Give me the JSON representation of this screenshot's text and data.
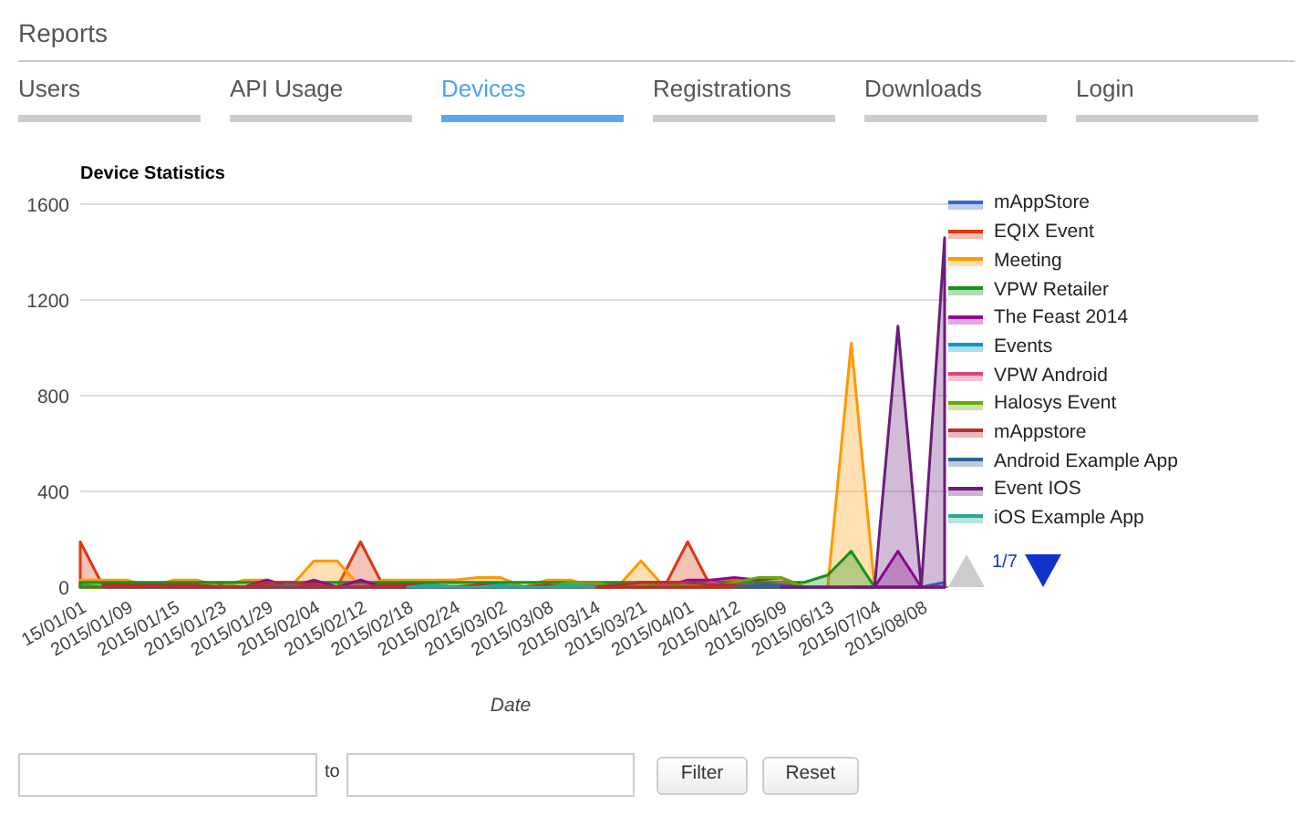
{
  "page_title": "Reports",
  "tabs": [
    {
      "label": "Users",
      "selected": false
    },
    {
      "label": "API Usage",
      "selected": false
    },
    {
      "label": "Devices",
      "selected": true
    },
    {
      "label": "Registrations",
      "selected": false
    },
    {
      "label": "Downloads",
      "selected": false
    },
    {
      "label": "Login",
      "selected": false
    }
  ],
  "chart": {
    "chart_data": {
      "type": "area",
      "title": "Device Statistics",
      "xlabel": "Date",
      "ylim": [
        0,
        1600
      ],
      "grid": true,
      "categories": [
        "15/01/01",
        null,
        "2015/01/09",
        null,
        "2015/01/15",
        null,
        "2015/01/23",
        null,
        "2015/01/29",
        null,
        "2015/02/04",
        null,
        "2015/02/12",
        null,
        "2015/02/18",
        null,
        "2015/02/24",
        null,
        "2015/03/02",
        null,
        "2015/03/08",
        null,
        "2015/03/14",
        null,
        "2015/03/21",
        null,
        "2015/04/01",
        null,
        "2015/04/12",
        null,
        "2015/05/09",
        null,
        "2015/06/13",
        null,
        "2015/07/04",
        null,
        "2015/08/08",
        null
      ],
      "yticks": [
        0,
        400,
        800,
        1200,
        1600
      ],
      "series": [
        {
          "name": "mAppStore",
          "color": "#3366cc",
          "values": [
            10,
            0,
            10,
            0,
            0,
            0,
            0,
            0,
            10,
            0,
            0,
            0,
            0,
            0,
            0,
            10,
            0,
            0,
            0,
            0,
            0,
            0,
            0,
            0,
            0,
            0,
            0,
            0,
            0,
            0,
            0,
            0,
            0,
            0,
            0,
            0,
            0,
            20
          ]
        },
        {
          "name": "EQIX Event",
          "color": "#dc3912",
          "values": [
            190,
            0,
            0,
            10,
            0,
            0,
            10,
            0,
            0,
            0,
            0,
            0,
            190,
            0,
            0,
            0,
            0,
            0,
            0,
            0,
            0,
            0,
            0,
            0,
            0,
            0,
            190,
            0,
            0,
            0,
            0,
            null,
            null,
            null,
            null,
            null,
            null,
            null
          ]
        },
        {
          "name": "Meeting",
          "color": "#ff9900",
          "values": [
            30,
            30,
            30,
            0,
            30,
            30,
            0,
            30,
            30,
            0,
            110,
            110,
            0,
            30,
            30,
            30,
            30,
            40,
            40,
            0,
            30,
            30,
            0,
            0,
            110,
            0,
            0,
            30,
            30,
            0,
            0,
            0,
            0,
            1020,
            0,
            0,
            0,
            0
          ]
        },
        {
          "name": "VPW Retailer",
          "color": "#109618",
          "values": [
            20,
            20,
            20,
            20,
            20,
            20,
            20,
            20,
            20,
            20,
            20,
            20,
            20,
            20,
            20,
            20,
            20,
            20,
            20,
            20,
            20,
            20,
            20,
            20,
            20,
            20,
            20,
            20,
            20,
            20,
            20,
            20,
            50,
            150,
            0,
            null,
            null,
            null
          ]
        },
        {
          "name": "The Feast 2014",
          "color": "#990099",
          "values": [
            null,
            null,
            null,
            null,
            0,
            0,
            0,
            0,
            30,
            0,
            30,
            0,
            30,
            0,
            10,
            0,
            0,
            0,
            0,
            0,
            0,
            0,
            0,
            0,
            0,
            0,
            30,
            30,
            40,
            30,
            40,
            0,
            0,
            0,
            0,
            150,
            0,
            0
          ]
        },
        {
          "name": "Events",
          "color": "#0099c6",
          "values": [
            null,
            10,
            0,
            0,
            0,
            0,
            0,
            0,
            0,
            10,
            0,
            0,
            0,
            0,
            0,
            0,
            0,
            0,
            0,
            0,
            0,
            null,
            null,
            null,
            null,
            null,
            null,
            null,
            null,
            null,
            null,
            null,
            null,
            null,
            null,
            null,
            null,
            null
          ]
        },
        {
          "name": "VPW Android",
          "color": "#dd4477",
          "values": [
            null,
            null,
            null,
            null,
            null,
            null,
            null,
            null,
            null,
            null,
            null,
            null,
            null,
            null,
            null,
            null,
            null,
            null,
            null,
            null,
            0,
            0,
            10,
            10,
            20,
            10,
            0,
            20,
            0,
            0,
            20,
            0,
            0,
            0,
            null,
            null,
            null,
            null
          ]
        },
        {
          "name": "Halosys Event",
          "color": "#66aa00",
          "values": [
            null,
            null,
            null,
            null,
            null,
            null,
            null,
            null,
            null,
            null,
            null,
            null,
            null,
            null,
            null,
            null,
            null,
            null,
            0,
            0,
            0,
            20,
            20,
            0,
            20,
            0,
            20,
            0,
            20,
            40,
            40,
            0,
            0,
            0,
            null,
            null,
            null,
            null
          ]
        },
        {
          "name": "mAppstore",
          "color": "#b82e2e",
          "values": [
            null,
            10,
            10,
            10,
            10,
            10,
            0,
            0,
            20,
            20,
            10,
            0,
            0,
            10,
            10,
            10,
            0,
            10,
            10,
            0,
            10,
            0,
            0,
            10,
            20,
            20,
            20,
            10,
            10,
            0,
            0,
            null,
            null,
            null,
            null,
            null,
            null,
            null
          ]
        },
        {
          "name": "Android Example App",
          "color": "#316395",
          "values": [
            null,
            null,
            null,
            null,
            null,
            null,
            null,
            null,
            null,
            null,
            null,
            null,
            null,
            null,
            null,
            null,
            null,
            null,
            null,
            null,
            null,
            null,
            null,
            null,
            null,
            null,
            null,
            null,
            0,
            10,
            10,
            0,
            0,
            null,
            null,
            null,
            null,
            null
          ]
        },
        {
          "name": "Event IOS",
          "color": "#6b1d7a",
          "values": [
            null,
            null,
            null,
            null,
            null,
            null,
            null,
            null,
            null,
            null,
            null,
            null,
            null,
            null,
            null,
            null,
            null,
            null,
            null,
            null,
            null,
            null,
            null,
            null,
            null,
            null,
            null,
            null,
            null,
            null,
            0,
            0,
            0,
            0,
            0,
            1090,
            0,
            1460
          ]
        },
        {
          "name": "iOS Example App",
          "color": "#22aa99",
          "values": [
            null,
            null,
            null,
            null,
            null,
            null,
            null,
            null,
            null,
            null,
            null,
            null,
            null,
            null,
            0,
            10,
            0,
            0,
            10,
            0,
            0,
            10,
            0,
            null,
            null,
            null,
            null,
            null,
            null,
            null,
            null,
            null,
            null,
            null,
            null,
            null,
            null,
            null
          ]
        }
      ]
    }
  },
  "legend_pager": {
    "page": "1/7",
    "previous_disabled": true,
    "next_disabled": false
  },
  "date_filter": {
    "separator": "to",
    "buttons": [
      "Filter",
      "Reset"
    ]
  }
}
